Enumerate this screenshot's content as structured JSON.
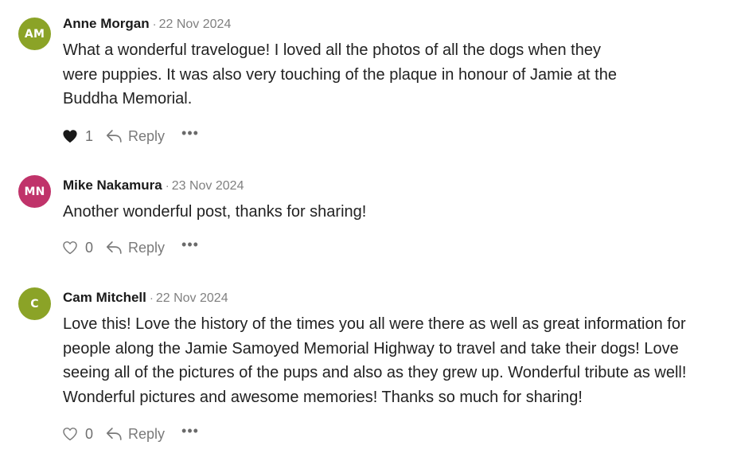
{
  "comments": [
    {
      "initials": "AM",
      "avatar_color": "#8ba327",
      "author": "Anne Morgan",
      "separator": "·",
      "date": "22 Nov 2024",
      "lines": [
        "What a wonderful travelogue! I loved all the photos of all the dogs when they",
        "were puppies. It was also very touching of the plaque in honour of Jamie at the",
        "Buddha Memorial."
      ],
      "liked": true,
      "like_count": "1",
      "reply_label": "Reply",
      "more_label": "•••"
    },
    {
      "initials": "MN",
      "avatar_color": "#c0336a",
      "author": "Mike Nakamura",
      "separator": "·",
      "date": "23 Nov 2024",
      "lines": [
        "Another wonderful post, thanks for sharing!"
      ],
      "liked": false,
      "like_count": "0",
      "reply_label": "Reply",
      "more_label": "•••"
    },
    {
      "initials": "C",
      "avatar_color": "#8ba327",
      "author": "Cam Mitchell",
      "separator": "·",
      "date": "22 Nov 2024",
      "lines": [
        "Love this! Love the history of the times you all were there as well as great information for",
        "people along the Jamie Samoyed Memorial Highway to travel and take their dogs! Love",
        "seeing all of the pictures of the pups and also as they grew up. Wonderful tribute as well!",
        "Wonderful pictures and awesome memories! Thanks so much for sharing!"
      ],
      "liked": false,
      "like_count": "0",
      "reply_label": "Reply",
      "more_label": "•••"
    }
  ],
  "icons": {
    "like_filled": "heart-filled-icon",
    "like_outline": "heart-outline-icon",
    "reply": "reply-arrow-icon",
    "more": "more-dots-icon"
  },
  "colors": {
    "heart_filled": "#1a1a1a",
    "icon_gray": "#7a7a7a"
  }
}
